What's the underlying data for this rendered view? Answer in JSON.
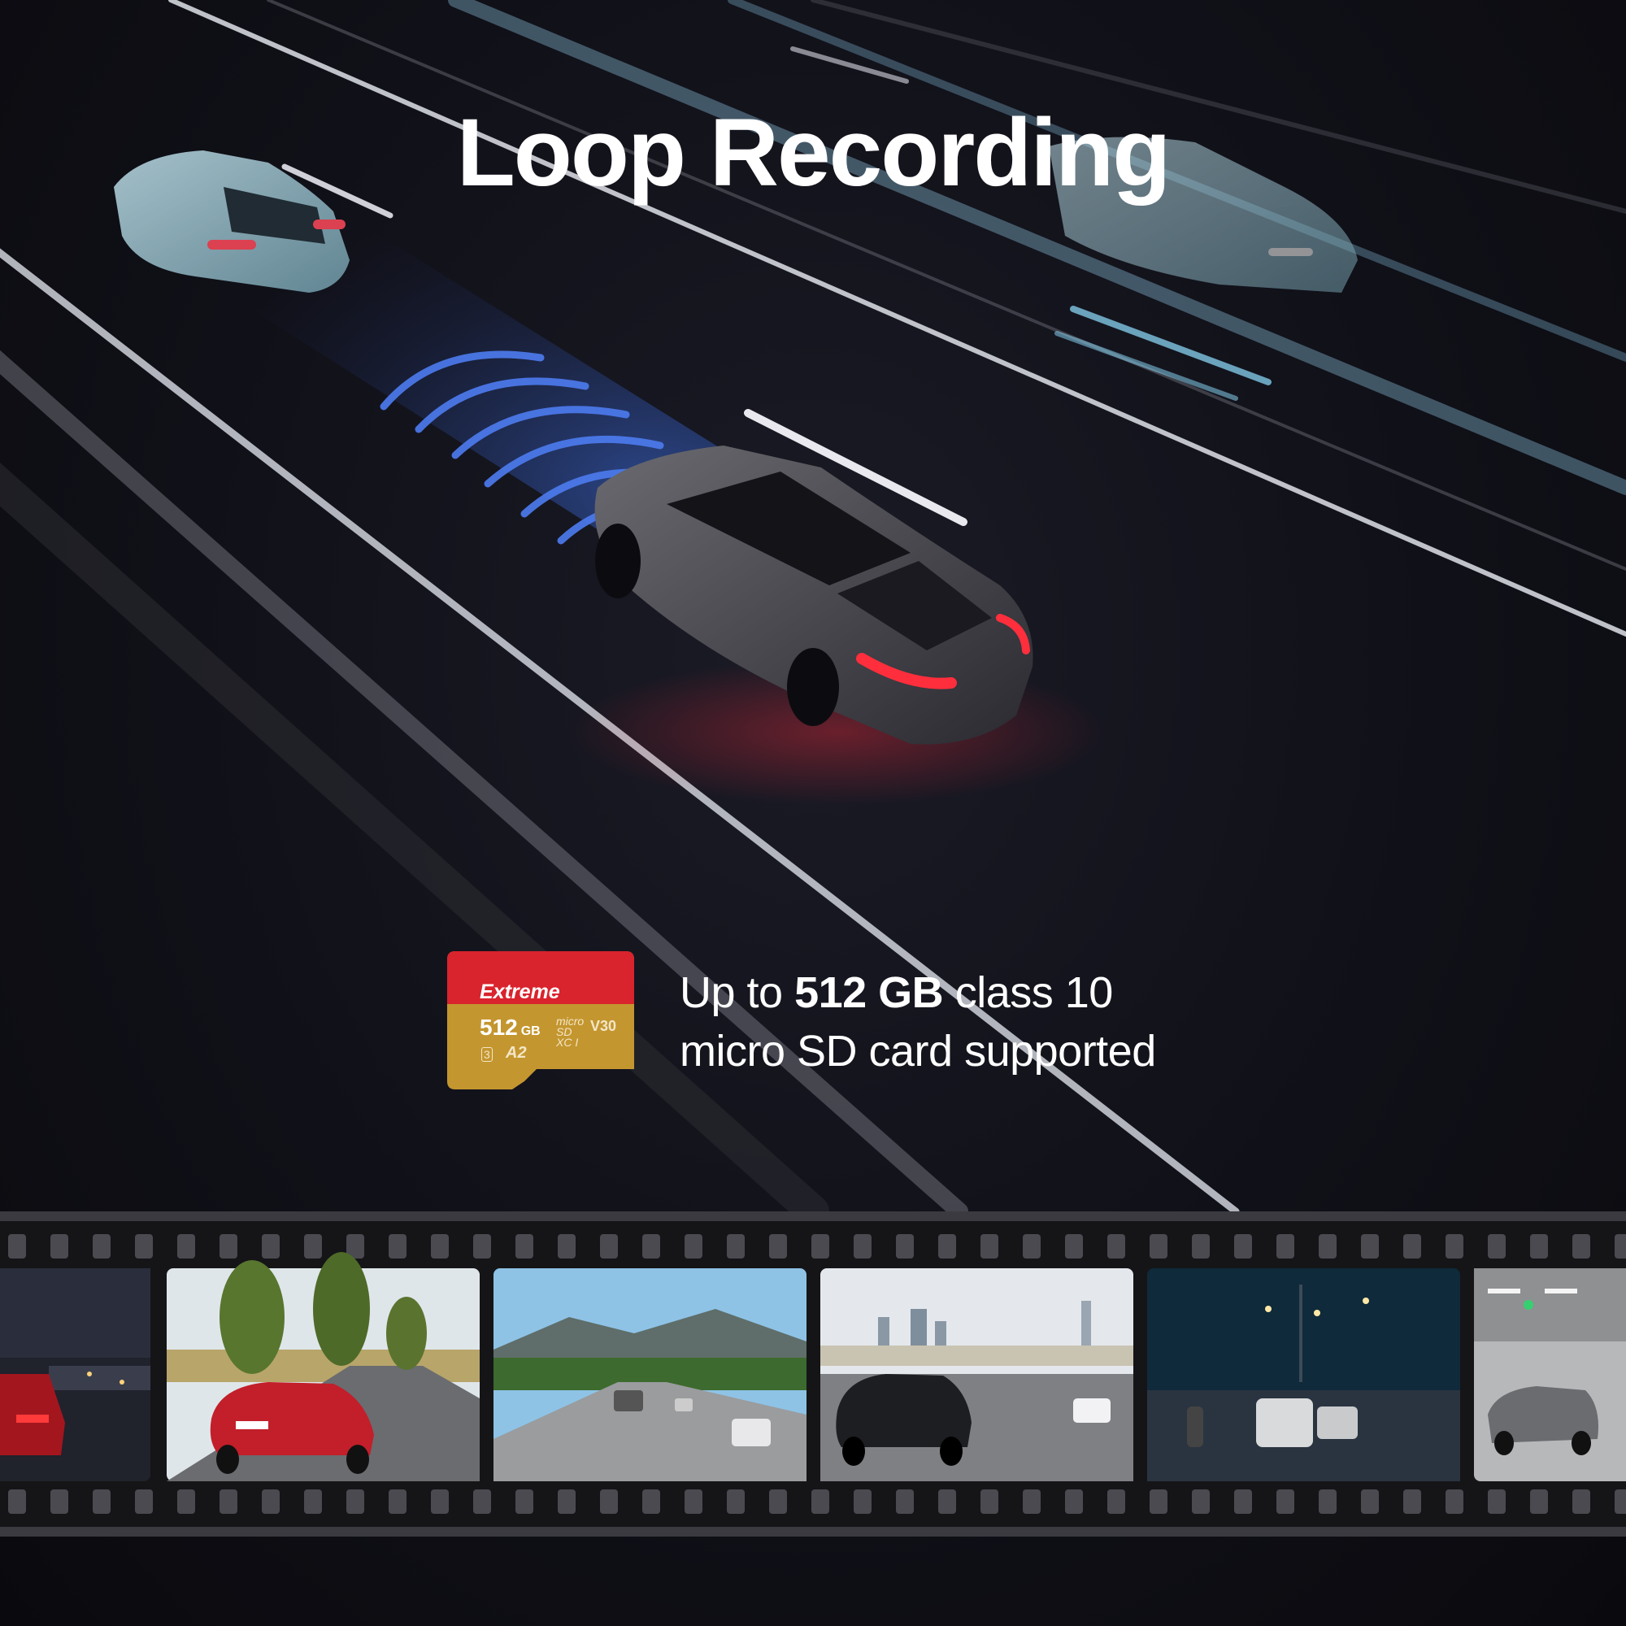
{
  "title": "Loop Recording",
  "sd_card": {
    "brand": "Extreme",
    "capacity": "512",
    "capacity_unit": "GB",
    "micro_label": "micro",
    "sd_label": "SD",
    "xc_label": "XC I",
    "speed_class": "V30",
    "uhs_class": "3",
    "app_class": "A2",
    "colors": {
      "top": "#d9232d",
      "bottom": "#c4962f"
    }
  },
  "feature": {
    "line1_prefix": "Up to ",
    "line1_bold": "512 GB",
    "line1_suffix": " class 10",
    "line2": "micro SD card supported"
  },
  "filmstrip": {
    "frames": [
      {
        "scene": "red SUV on elevated highway at night"
      },
      {
        "scene": "red sedan on road with trees"
      },
      {
        "scene": "freeway traffic with mountains"
      },
      {
        "scene": "black minivan on highway with city skyline"
      },
      {
        "scene": "motorcycles and cars on road at night"
      },
      {
        "scene": "cars in underground parking garage"
      }
    ]
  }
}
